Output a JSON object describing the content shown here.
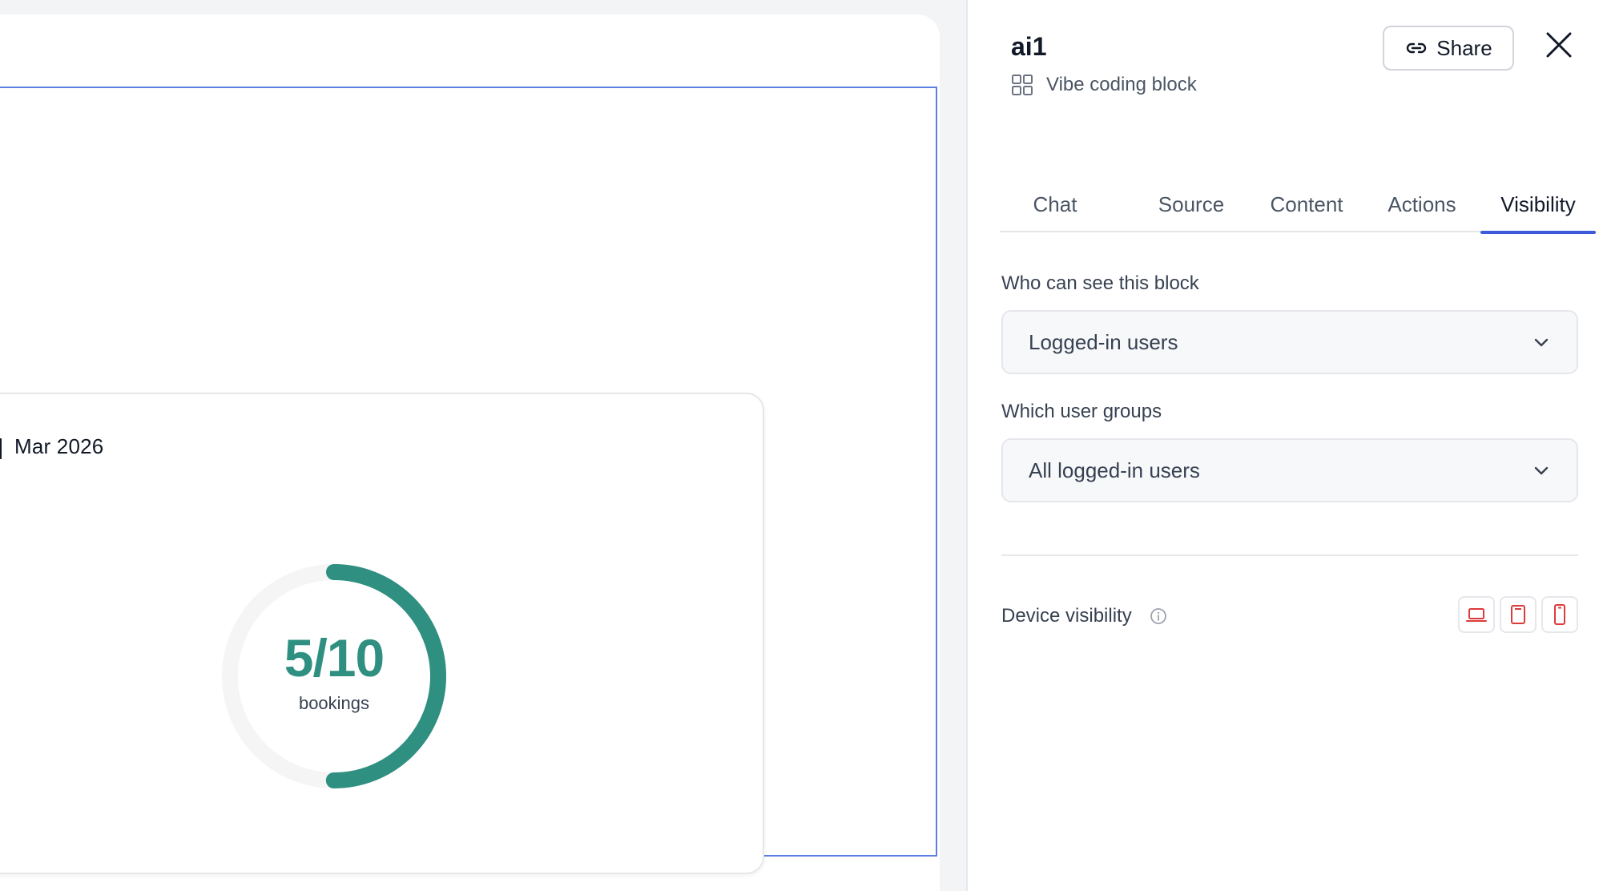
{
  "canvas": {
    "widget": {
      "month_label": "Mar 2026",
      "ring": {
        "value_text": "5/10",
        "caption": "bookings",
        "current": 5,
        "total": 10,
        "color": "#2f8f80"
      }
    }
  },
  "panel": {
    "title": "ai1",
    "subtitle": "Vibe coding block",
    "subtitle_icon": "grid-icon",
    "share_label": "Share",
    "tabs": [
      {
        "label": "Chat",
        "active": false
      },
      {
        "label": "Source",
        "active": false
      },
      {
        "label": "Content",
        "active": false
      },
      {
        "label": "Actions",
        "active": false
      },
      {
        "label": "Visibility",
        "active": true
      }
    ],
    "visibility": {
      "who_label": "Who can see this block",
      "who_value": "Logged-in users",
      "groups_label": "Which user groups",
      "groups_value": "All logged-in users",
      "device_label": "Device visibility",
      "devices": [
        "desktop-icon",
        "tablet-icon",
        "mobile-icon"
      ],
      "device_icon_color": "#dc3b3b"
    },
    "accent_color": "#3b5bdb"
  }
}
